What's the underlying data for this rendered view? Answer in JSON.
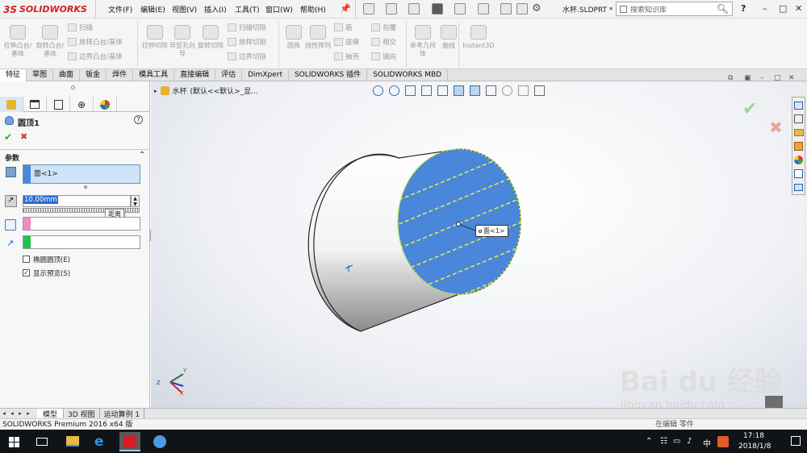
{
  "app": {
    "brand_ds": "3S",
    "brand_name": "SOLIDWORKS",
    "document_title": "水杯.SLDPRT *"
  },
  "menu": [
    "文件(F)",
    "编辑(E)",
    "视图(V)",
    "插入(I)",
    "工具(T)",
    "窗口(W)",
    "帮助(H)"
  ],
  "search": {
    "placeholder": "搜索知识库"
  },
  "help_label": "?",
  "ribbon": {
    "big": [
      "拉伸凸台/基体",
      "旋转凸台/基体",
      "拉伸切除",
      "异型孔向导",
      "旋转切除",
      "圆角",
      "线性阵列",
      "参考几何体",
      "曲线",
      "Instant3D"
    ],
    "small_col1": [
      "扫描",
      "放样凸台/基体",
      "边界凸台/基体"
    ],
    "small_col2": [
      "扫描切除",
      "放样切割",
      "边界切除"
    ],
    "small_col3": [
      "筋",
      "拔模",
      "抽壳"
    ],
    "small_col4": [
      "包覆",
      "相交",
      "镜向"
    ]
  },
  "tabs": [
    "特征",
    "草图",
    "曲面",
    "钣金",
    "焊件",
    "模具工具",
    "直接编辑",
    "评估",
    "DimXpert",
    "SOLIDWORKS 插件",
    "SOLIDWORKS MBD"
  ],
  "property_manager": {
    "feature_title": "圆顶1",
    "section_label": "参数",
    "face_value": "面<1>",
    "distance_value": "10.00mm",
    "distance_tooltip": "距离",
    "elliptical_label": "椭圆圆顶(E)",
    "preview_label": "显示预览(S)",
    "elliptical_checked": false,
    "preview_checked": true
  },
  "feature_tree": {
    "part_name": "水杯",
    "config": "(默认<<默认>_显..."
  },
  "viewport": {
    "face_callout": "面<1>",
    "triad_x": "X",
    "triad_y": "Y",
    "triad_z": "Z"
  },
  "bottom_tabs": [
    "模型",
    "3D 视图",
    "运动算例 1"
  ],
  "status": {
    "text": "SOLIDWORKS Premium 2016 x64 版",
    "right_text": "在编辑 零件"
  },
  "taskbar": {
    "time": "17:18",
    "date": "2018/1/8",
    "ime": "中"
  },
  "watermark": {
    "brand": "Bai du 经验",
    "url": "jingyan.baidu.com"
  },
  "colors": {
    "accent_red": "#d31e25",
    "face_blue": "#4a86d9",
    "ok_green": "#3aa335",
    "cancel_red": "#d23a2a"
  }
}
